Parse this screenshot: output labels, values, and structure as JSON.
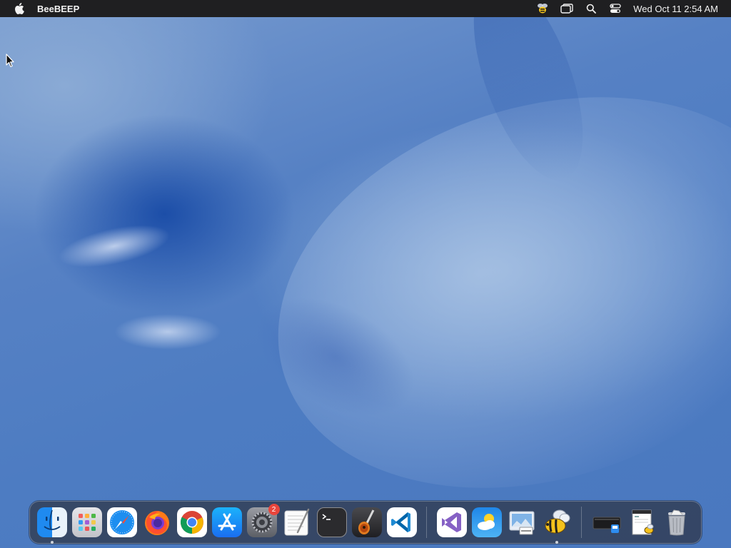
{
  "menubar": {
    "app_name": "BeeBEEP",
    "clock": "Wed Oct 11  2:54 AM",
    "status_icons": [
      "beebeep-status-icon",
      "window-mirror-icon",
      "spotlight-search-icon",
      "control-center-icon"
    ]
  },
  "dock": {
    "apps": [
      {
        "name": "Finder",
        "icon": "finder-icon",
        "running": true
      },
      {
        "name": "Launchpad",
        "icon": "launchpad-icon",
        "running": false
      },
      {
        "name": "Safari",
        "icon": "safari-icon",
        "running": false
      },
      {
        "name": "Firefox",
        "icon": "firefox-icon",
        "running": false
      },
      {
        "name": "Google Chrome",
        "icon": "chrome-icon",
        "running": false
      },
      {
        "name": "App Store",
        "icon": "app-store-icon",
        "running": false
      },
      {
        "name": "System Settings",
        "icon": "system-settings-icon",
        "running": false,
        "badge": "2"
      },
      {
        "name": "TextEdit",
        "icon": "textedit-icon",
        "running": false
      },
      {
        "name": "Terminal",
        "icon": "terminal-icon",
        "running": false
      },
      {
        "name": "GarageBand",
        "icon": "garageband-icon",
        "running": false
      },
      {
        "name": "Visual Studio Code",
        "icon": "vscode-icon",
        "running": false
      },
      {
        "name": "Visual Studio",
        "icon": "visual-studio-icon",
        "running": false
      },
      {
        "name": "Weather",
        "icon": "weather-icon",
        "running": false
      },
      {
        "name": "Preview",
        "icon": "preview-icon",
        "running": false
      },
      {
        "name": "BeeBEEP",
        "icon": "beebeep-icon",
        "running": true
      }
    ],
    "stack_items": [
      {
        "name": "Downloads",
        "icon": "downloads-stack-icon"
      },
      {
        "name": "Documents",
        "icon": "documents-stack-icon"
      },
      {
        "name": "Trash",
        "icon": "trash-icon"
      }
    ]
  },
  "colors": {
    "menubar": "#1f1f21",
    "wallpaper": "#4f7cc1",
    "badge": "#e8453c"
  }
}
